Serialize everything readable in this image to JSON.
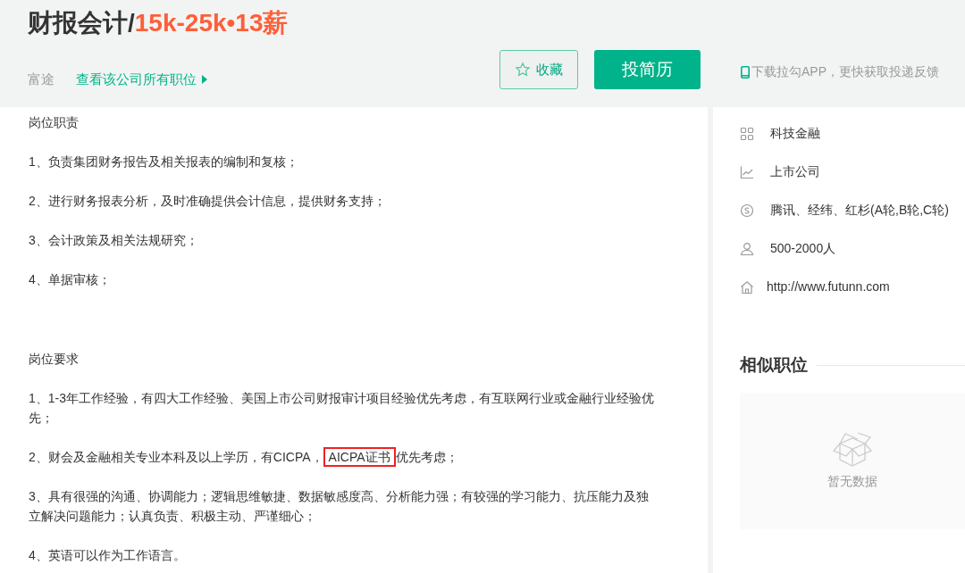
{
  "header": {
    "title": "财报会计/",
    "salary": "15k-25k•13薪",
    "company": "富途",
    "all_jobs_link": "查看该公司所有职位",
    "favorite_button": "收藏",
    "apply_button": "投简历",
    "app_hint": "下载拉勾APP，更快获取投递反馈"
  },
  "description": {
    "sections": [
      {
        "heading": "岗位职责",
        "items": [
          {
            "text": "1、负责集团财务报告及相关报表的编制和复核；"
          },
          {
            "text": "2、进行财务报表分析，及时准确提供会计信息，提供财务支持；"
          },
          {
            "text": "3、会计政策及相关法规研究；"
          },
          {
            "text": "4、单据审核；"
          }
        ]
      },
      {
        "heading": "岗位要求",
        "items": [
          {
            "text": "1、1-3年工作经验，有四大工作经验、美国上市公司财报审计项目经验优先考虑，有互联网行业或金融行业经验优先；"
          },
          {
            "text": "2、财会及金融相关专业本科及以上学历，有CICPA，",
            "highlight": "AICPA证书",
            "text_after": "优先考虑；"
          },
          {
            "text": "3、具有很强的沟通、协调能力；逻辑思维敏捷、数据敏感度高、分析能力强；有较强的学习能力、抗压能力及独立解决问题能力；认真负责、积极主动、严谨细心；"
          },
          {
            "text": "4、英语可以作为工作语言。"
          }
        ]
      }
    ]
  },
  "company_info": [
    {
      "kind": "industry",
      "text": "科技金融"
    },
    {
      "kind": "stage",
      "text": "上市公司"
    },
    {
      "kind": "investors",
      "text": "腾讯、经纬、红杉(A轮,B轮,C轮)"
    },
    {
      "kind": "size",
      "text": "500-2000人"
    },
    {
      "kind": "website",
      "text": "http://www.futunn.com"
    }
  ],
  "similar_jobs": {
    "title": "相似职位",
    "empty_text": "暂无数据"
  }
}
